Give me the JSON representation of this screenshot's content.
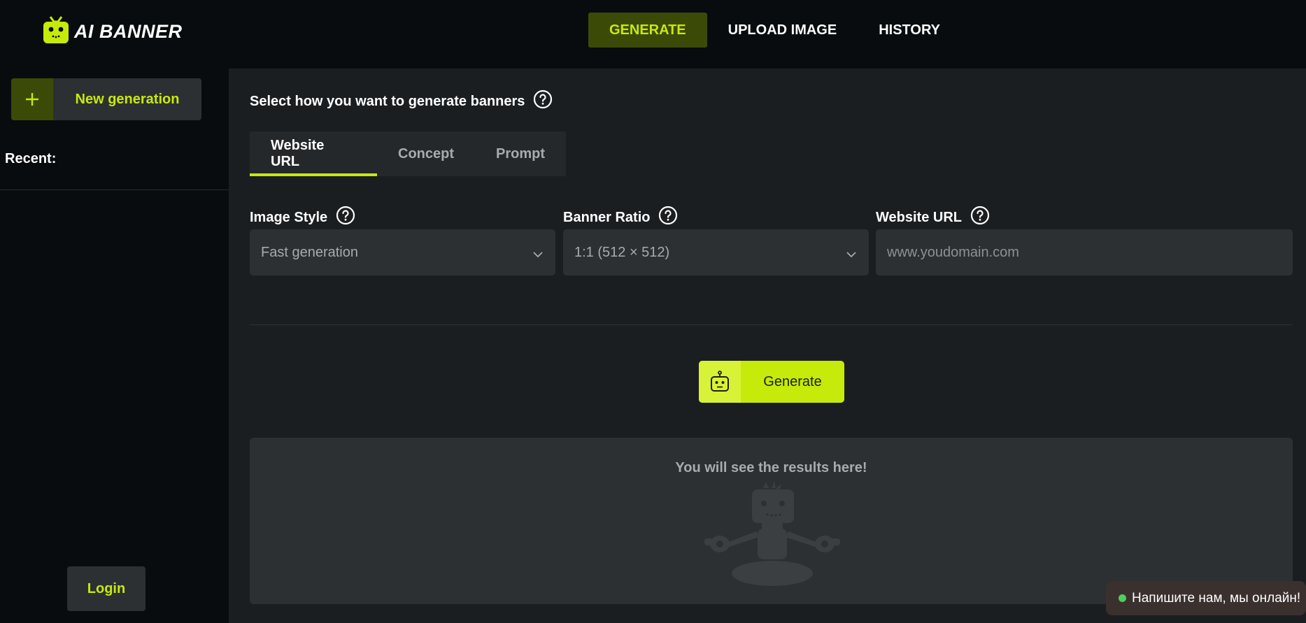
{
  "header": {
    "logo_text": "AI BANNER",
    "nav": [
      {
        "label": "GENERATE",
        "active": true
      },
      {
        "label": "UPLOAD IMAGE",
        "active": false
      },
      {
        "label": "HISTORY",
        "active": false
      }
    ]
  },
  "sidebar": {
    "new_generation_label": "New generation",
    "recent_label": "Recent:",
    "login_label": "Login"
  },
  "main": {
    "heading": "Select how you want to generate banners",
    "tabs": [
      {
        "label": "Website URL",
        "active": true
      },
      {
        "label": "Concept",
        "active": false
      },
      {
        "label": "Prompt",
        "active": false
      }
    ],
    "image_style": {
      "label": "Image Style",
      "value": "Fast generation"
    },
    "banner_ratio": {
      "label": "Banner Ratio",
      "value": "1:1 (512 × 512)"
    },
    "website_url": {
      "label": "Website URL",
      "value": "",
      "placeholder": "www.youdomain.com"
    },
    "generate_label": "Generate",
    "results_text": "You will see the results here!"
  },
  "chat": {
    "label": "Напишите нам, мы онлайн!"
  },
  "colors": {
    "accent": "#c6ea0a",
    "accent_dark": "#3c4a08",
    "panel": "#2c3033",
    "main_bg": "#1b1e21",
    "page_bg": "#080c0e",
    "online": "#4bd05a"
  },
  "icons": {
    "logo": "robot-icon",
    "help": "question-circle-icon",
    "dropdown": "chevron-down-icon",
    "plus": "plus-icon",
    "generate": "robot-icon",
    "results_illustration": "meditating-robot-illustration"
  }
}
